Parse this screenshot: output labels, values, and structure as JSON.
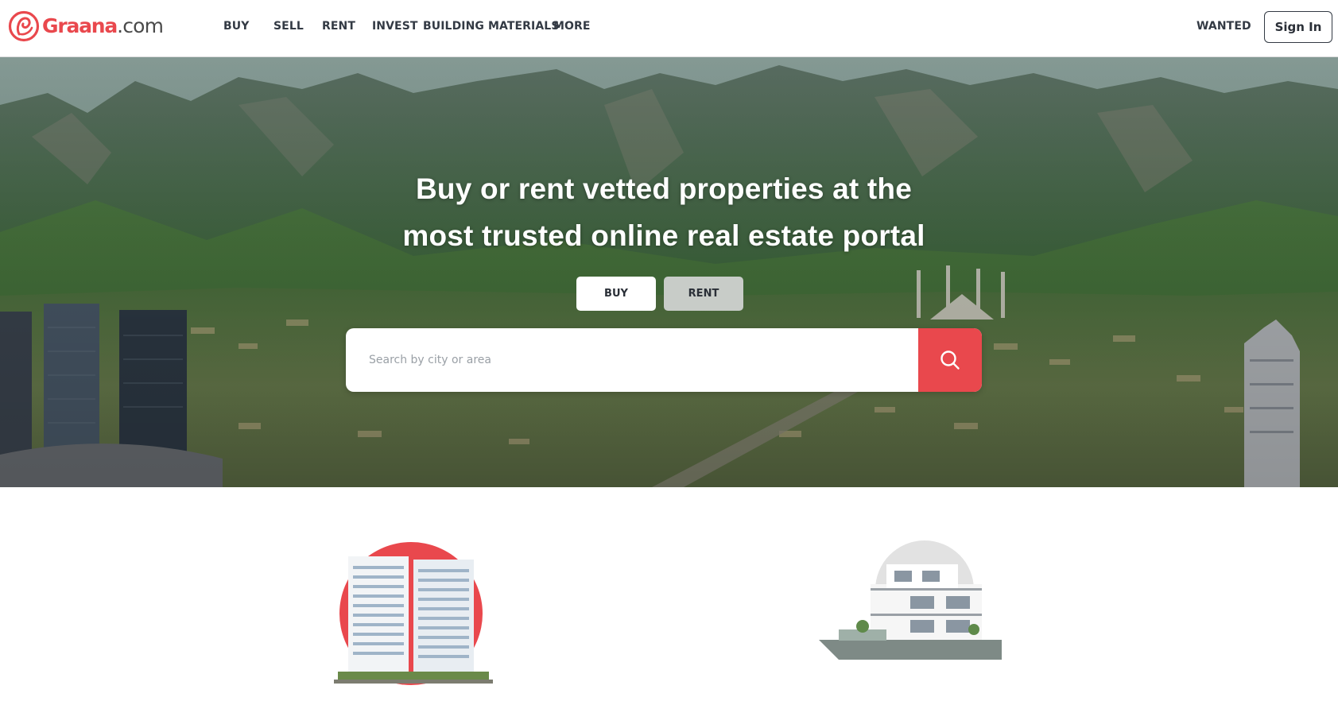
{
  "brand": {
    "name": "Graana",
    "domain": ".com",
    "color": "#e9484d"
  },
  "nav": {
    "items": [
      {
        "label": "BUY"
      },
      {
        "label": "SELL"
      },
      {
        "label": "RENT"
      },
      {
        "label": "INVEST"
      },
      {
        "label": "BUILDING MATERIALS"
      },
      {
        "label": "MORE"
      }
    ],
    "wanted_label": "WANTED",
    "signin_label": "Sign In"
  },
  "hero": {
    "title_line1": "Buy or rent vetted properties at the",
    "title_line2": "most trusted online real estate portal",
    "tabs": [
      {
        "label": "BUY",
        "active": true
      },
      {
        "label": "RENT",
        "active": false
      }
    ],
    "search": {
      "placeholder": "Search by city or area",
      "value": "",
      "icon": "search-icon"
    }
  },
  "sections": {
    "cards": [
      {
        "image": "residential-tower-illustration",
        "accent": "#e9484d"
      },
      {
        "image": "modern-house-illustration",
        "accent": "#d9d9d9"
      }
    ]
  }
}
